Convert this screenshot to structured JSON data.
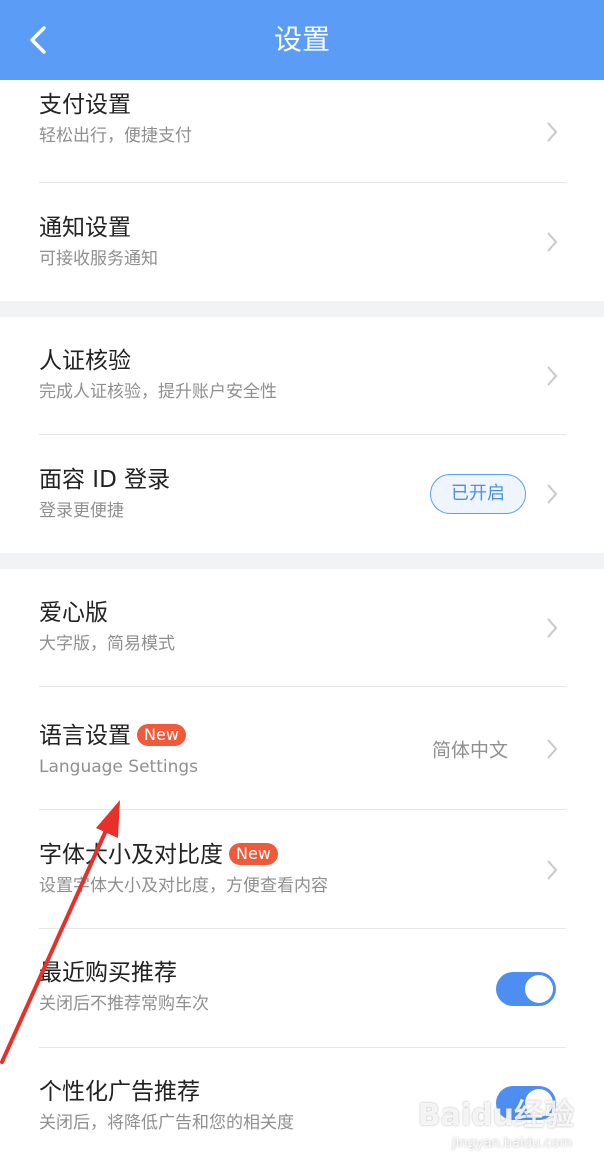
{
  "header": {
    "title": "设置",
    "back_icon": "chevron-left-icon",
    "bg_color": "#5a9cf6"
  },
  "sections": [
    {
      "rows": [
        {
          "title": "支付设置",
          "subtitle": "轻松出行，便捷支付"
        },
        {
          "title": "通知设置",
          "subtitle": "可接收服务通知"
        }
      ]
    },
    {
      "rows": [
        {
          "title": "人证核验",
          "subtitle": "完成人证核验，提升账户安全性"
        },
        {
          "title": "面容 ID 登录",
          "subtitle": "登录更便捷",
          "status": "已开启"
        }
      ]
    },
    {
      "rows": [
        {
          "title": "爱心版",
          "subtitle": "大字版，简易模式"
        },
        {
          "title": "语言设置",
          "badge": "New",
          "subtitle": "Language Settings",
          "value": "简体中文"
        },
        {
          "title": "字体大小及对比度",
          "badge": "New",
          "subtitle": "设置字体大小及对比度，方便查看内容"
        },
        {
          "title": "最近购买推荐",
          "subtitle": "关闭后不推荐常购车次",
          "toggle_on": true
        },
        {
          "title": "个性化广告推荐",
          "subtitle": "关闭后，将降低广告和您的相关度",
          "toggle_on": true
        }
      ]
    }
  ],
  "watermark": {
    "logo": "Baidu经验",
    "url": "jingyan.baidu.com"
  },
  "colors": {
    "accent": "#5a9cf6",
    "badge": "#f05a3a",
    "annotation_arrow": "#e8302a"
  }
}
